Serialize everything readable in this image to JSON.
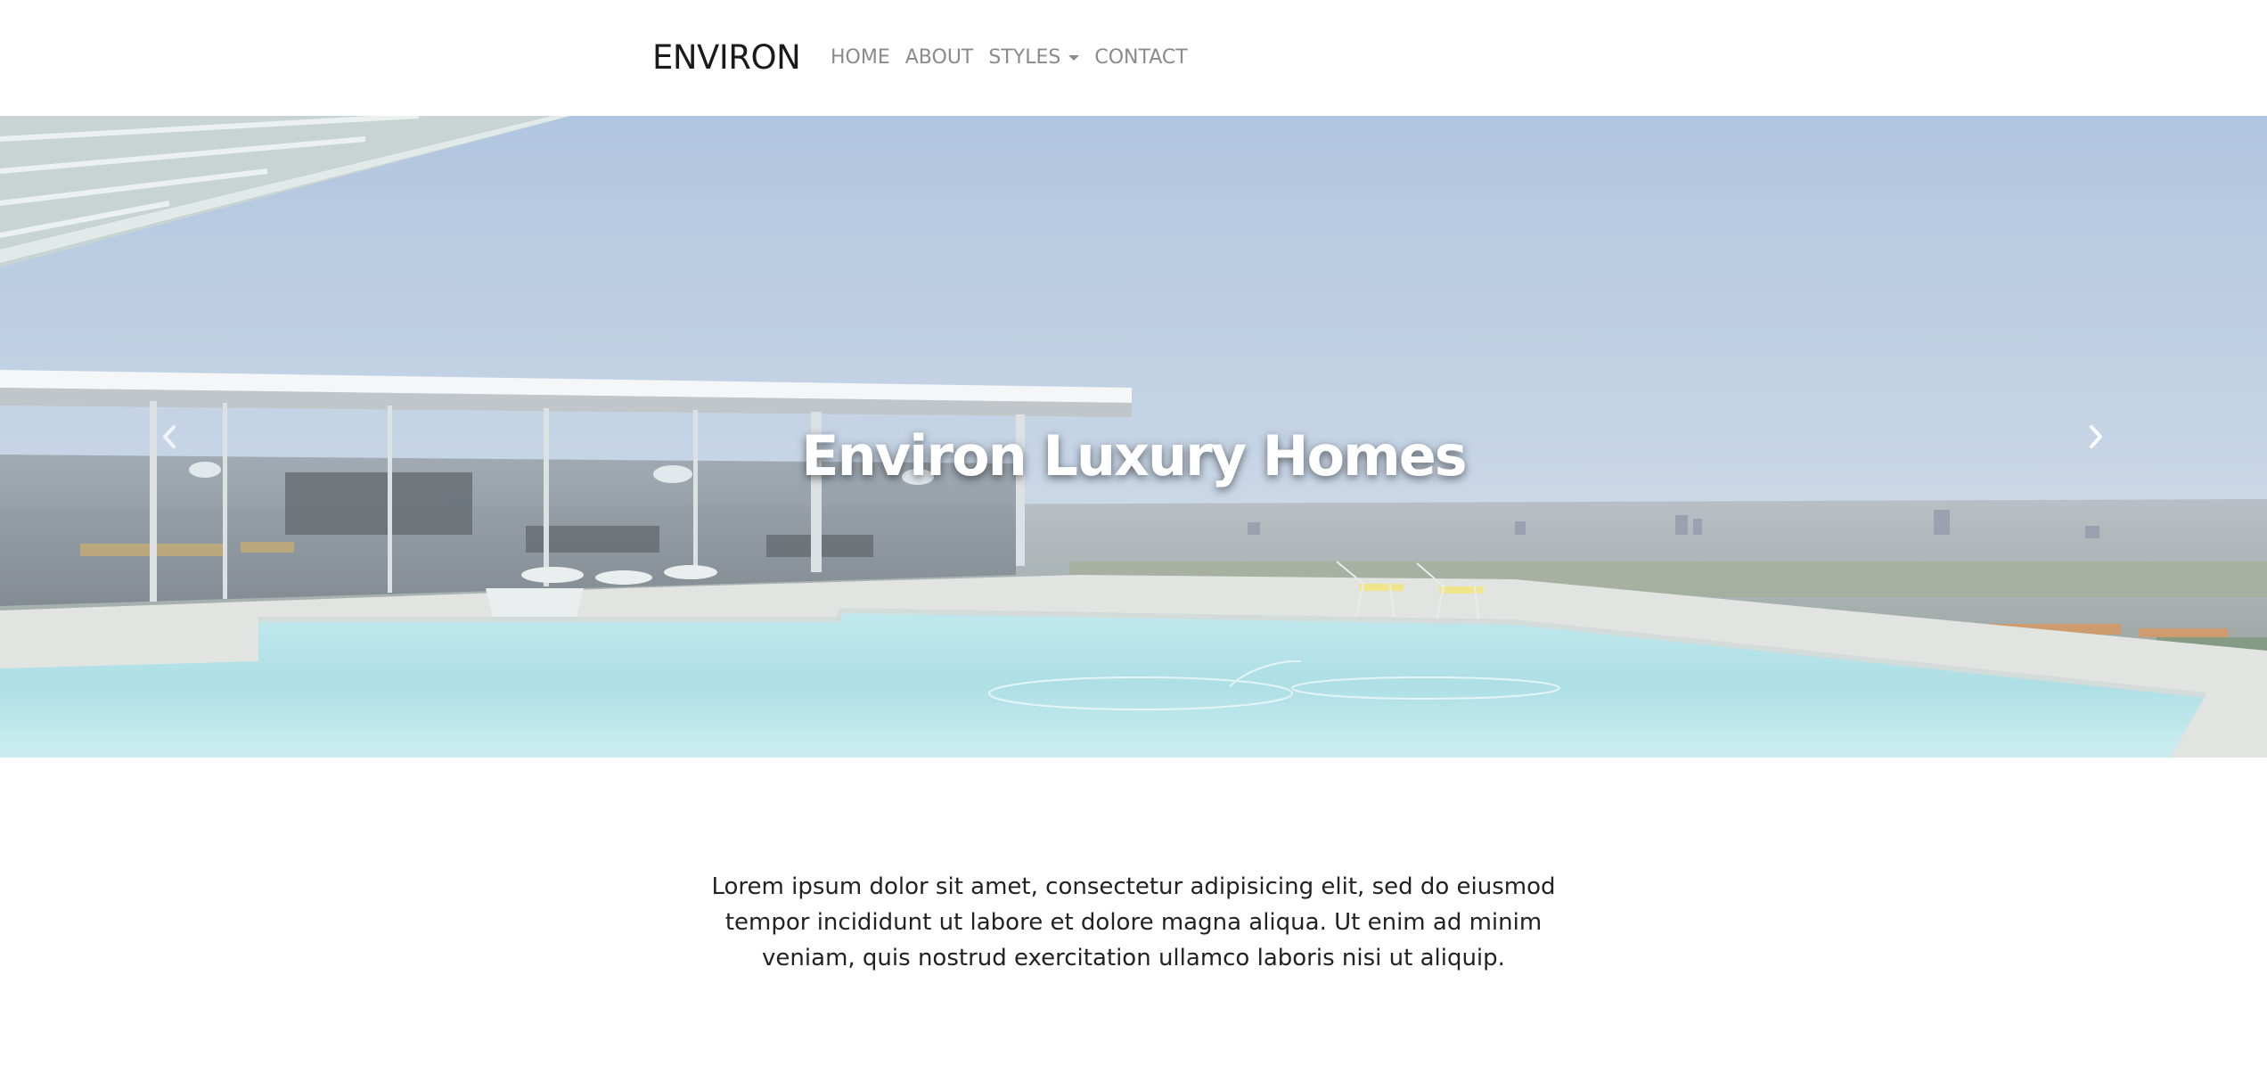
{
  "navbar": {
    "brand": "ENVIRON",
    "items": [
      {
        "label": "HOME"
      },
      {
        "label": "ABOUT"
      },
      {
        "label": "STYLES",
        "has_dropdown": true
      },
      {
        "label": "CONTACT"
      }
    ]
  },
  "hero": {
    "title": "Environ Luxury Homes",
    "prev_icon": "chevron-left-icon",
    "next_icon": "chevron-right-icon"
  },
  "content": {
    "intro": "Lorem ipsum dolor sit amet, consectetur adipisicing elit, sed do eiusmod tempor incididunt ut labore et dolore magna aliqua. Ut enim ad minim veniam, quis nostrud exercitation ullamco laboris nisi ut aliquip."
  },
  "colors": {
    "nav_text": "#8a8a8a",
    "brand_text": "#1a1a1a",
    "body_text": "#222222",
    "sky": "#a9c0dc",
    "pool": "#a9dde2"
  }
}
